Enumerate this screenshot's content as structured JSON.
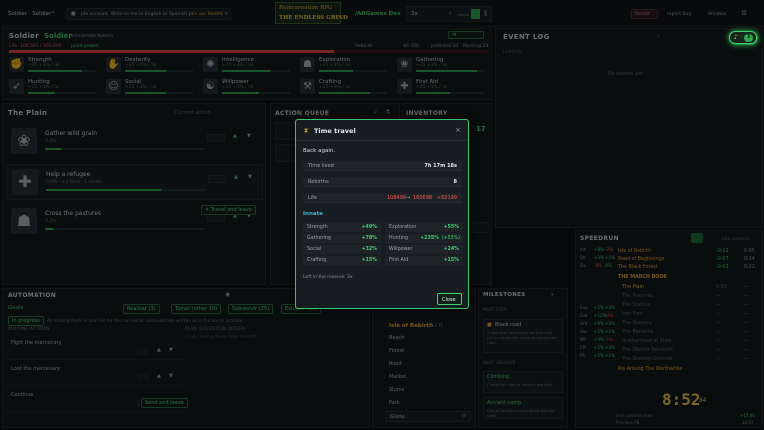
{
  "topbar": {
    "profile": "Soldier · Soldier",
    "notice": "ple account. Write to me in English or Spanish.",
    "notice_link": "Join our Reddit",
    "logo_top": "Reincarnation RPG",
    "logo_bottom": "THE ENDLESS GRIND",
    "sponsor": "/AltGames Dev",
    "speed": "3x",
    "reddit": "Reddit",
    "report": "report bug",
    "window": "Window"
  },
  "character": {
    "name": "Soldier",
    "class": "Soldier",
    "reborn": "Reincarnate Reborn",
    "life": "Life",
    "life_value": "108,501 / 160,000",
    "points": "point-powell",
    "stat_a": "Rebuild",
    "stat_b": "$0 700",
    "stat_c": "potential 10",
    "stat_d": "Morning 23"
  },
  "skills": [
    {
      "name": "Strength",
      "sub": "+25  +3% / lvl",
      "icon": "strength-icon",
      "glyph": "✊",
      "pct": 0.8
    },
    {
      "name": "Dexterity",
      "sub": "+25  +3% / lvl",
      "icon": "dexterity-icon",
      "glyph": "✋",
      "pct": 0.6
    },
    {
      "name": "Intelligence",
      "sub": "+25  +3% / lvl",
      "icon": "intelligence-icon",
      "glyph": "✺",
      "pct": 0.7
    },
    {
      "name": "Exploration",
      "sub": "+25  +3% / lvl",
      "icon": "exploration-icon",
      "glyph": "☗",
      "pct": 0.5
    },
    {
      "name": "Gathering",
      "sub": "+25  +3% / lvl",
      "icon": "gathering-icon",
      "glyph": "❀",
      "pct": 0.9
    },
    {
      "name": "Hunting",
      "sub": "+25  +3% / lvl",
      "icon": "hunting-icon",
      "glyph": "➶",
      "pct": 0.4
    },
    {
      "name": "Social",
      "sub": "+25  +3% / lvl",
      "icon": "social-icon",
      "glyph": "☺",
      "pct": 0.6
    },
    {
      "name": "Willpower",
      "sub": "+25  +3% / lvl",
      "icon": "willpower-icon",
      "glyph": "☯",
      "pct": 0.55
    },
    {
      "name": "Crafting",
      "sub": "+25  +3% / lvl",
      "icon": "crafting-icon",
      "glyph": "⚒",
      "pct": 0.75
    },
    {
      "name": "First Aid",
      "sub": "+25  +3% / lvl",
      "icon": "first-aid-icon",
      "glyph": "✚",
      "pct": 0.5
    }
  ],
  "location": {
    "title": "The Plain",
    "current_action": "Current action",
    "actions": [
      {
        "name": "Gather wild grain",
        "sub": "0.8%",
        "pct": 0.1
      },
      {
        "name": "Help a refugee",
        "sub": "0.0%  ·  +2 food  ·  1 assist",
        "pct": 0.72
      },
      {
        "name": "Cross the pastures",
        "sub": "0.2%",
        "pct": 0.05
      }
    ],
    "travel_label": "Travel and leave"
  },
  "action_queue": {
    "title": "ACTION QUEUE"
  },
  "inventory": {
    "title": "INVENTORY",
    "count": "17"
  },
  "event_log": {
    "title": "EVENT LOG",
    "sub": "Loading",
    "empty": "No events yet",
    "badge": "3"
  },
  "automation": {
    "title": "AUTOMATION",
    "goals": "Goals",
    "btn_1": "Realizar (3)",
    "btn_2": "Tomar (other 10)",
    "btn_3": "Sobrevivir (25)",
    "btn_4": "Estudiar (25)",
    "mode": "In progress",
    "info": "All missing fields in your list for this run will be automatically written as in the bar to activate.",
    "routine_title": "ROUTINE ACTIONS",
    "plan_title": "PLAN (EXECUTION ORDER)",
    "plan_sub": "Drag / add actions from the left",
    "rows": [
      "Fight the mercenary",
      "Loot the mercenary",
      "Continue"
    ],
    "add_label": "Send and leave"
  },
  "locations_list": {
    "title": "Isle of Rebirth",
    "count": "(1 / 7)",
    "items": [
      "Beach",
      "Forest",
      "Road",
      "Market",
      "Slums",
      "Park",
      "Glade"
    ]
  },
  "milestones": {
    "title": "MILESTONES",
    "label": "NEXT STEP",
    "m1": "Black road",
    "m1_sub": "A well-trod road leads off from the camp. Leave the camp to unlock the road.",
    "label2": "NEXT UNLOCKS",
    "m2": "Climbing",
    "m2_sub": "Climb the cliffs to unlock new skill.",
    "m3": "Ancient camp",
    "m3_sub": "Find an ancient camp along the old road."
  },
  "speedrun": {
    "title": "SPEEDRUN",
    "chip": "Auto-speedrun",
    "left_rows": [
      [
        "Int",
        "+8%",
        "-2%"
      ],
      [
        "Str",
        "+2%",
        "+1%"
      ],
      [
        "Dx",
        "-8%",
        "0%"
      ],
      [
        "Exp",
        "+2%",
        "+3%"
      ],
      [
        "Gat",
        "+12%",
        "-4%"
      ],
      [
        "Hnt",
        "+6%",
        "+2%"
      ],
      [
        "Soc",
        "+2%",
        "+1%"
      ],
      [
        "Wil",
        "+4%",
        "-1%"
      ],
      [
        "Cft",
        "+2%",
        "+3%"
      ],
      [
        "FA",
        "+5%",
        "+1%"
      ]
    ],
    "splits": [
      [
        "Isle of Rebirth",
        "-0:11",
        "0:05"
      ],
      [
        "Road of Beginnings",
        "-0:07",
        "0:14"
      ],
      [
        "The Black Forest",
        "-0:03",
        "0:22"
      ]
    ],
    "section": "THE MARCH BOOK",
    "splits2": [
      [
        "The Plain",
        "0:00",
        "—"
      ],
      [
        "The Pastures",
        "—",
        "—"
      ],
      [
        "The Stables",
        "—",
        "—"
      ],
      [
        "Iron Fort",
        "—",
        "—"
      ],
      [
        "The Ossuary",
        "—",
        "—"
      ],
      [
        "The Barracks",
        "—",
        "—"
      ],
      [
        "Brotherhood of Steel",
        "—",
        "—"
      ],
      [
        "The Warrior Sanctum",
        "—",
        "—"
      ],
      [
        "The Dueling Grounds",
        "—",
        "—"
      ]
    ],
    "final": "Ris Among The Worthwhile",
    "timer": "8:52",
    "timer_ms": "84",
    "foot_1_label": "Best possible time",
    "foot_1": "+15:00",
    "foot_2_label": "Previous PB",
    "foot_2": "12:37"
  },
  "modal": {
    "title": "Time travel",
    "greeting": "Back again.",
    "time_lived_label": "Time lived",
    "time_lived": "7h 17m 18s",
    "rebirths_label": "Rebirths",
    "rebirths": "8",
    "life_label": "Life",
    "life_from": "108499",
    "life_to": "160698",
    "life_delta": "+52199",
    "innate_title": "Innate",
    "innates": [
      {
        "label": "Strength",
        "value": "+49%"
      },
      {
        "label": "Exploration",
        "value": "+55%"
      },
      {
        "label": "Gathering",
        "value": "+78%"
      },
      {
        "label": "Hunting",
        "value": "+235%",
        "extra": "(+53%)"
      },
      {
        "label": "Social",
        "value": "+32%"
      },
      {
        "label": "Willpower",
        "value": "+24%"
      },
      {
        "label": "Crafting",
        "value": "+15%"
      },
      {
        "label": "First Aid",
        "value": "+15%"
      }
    ],
    "reserve": "Left in the reserve: 2x",
    "close": "Close"
  }
}
